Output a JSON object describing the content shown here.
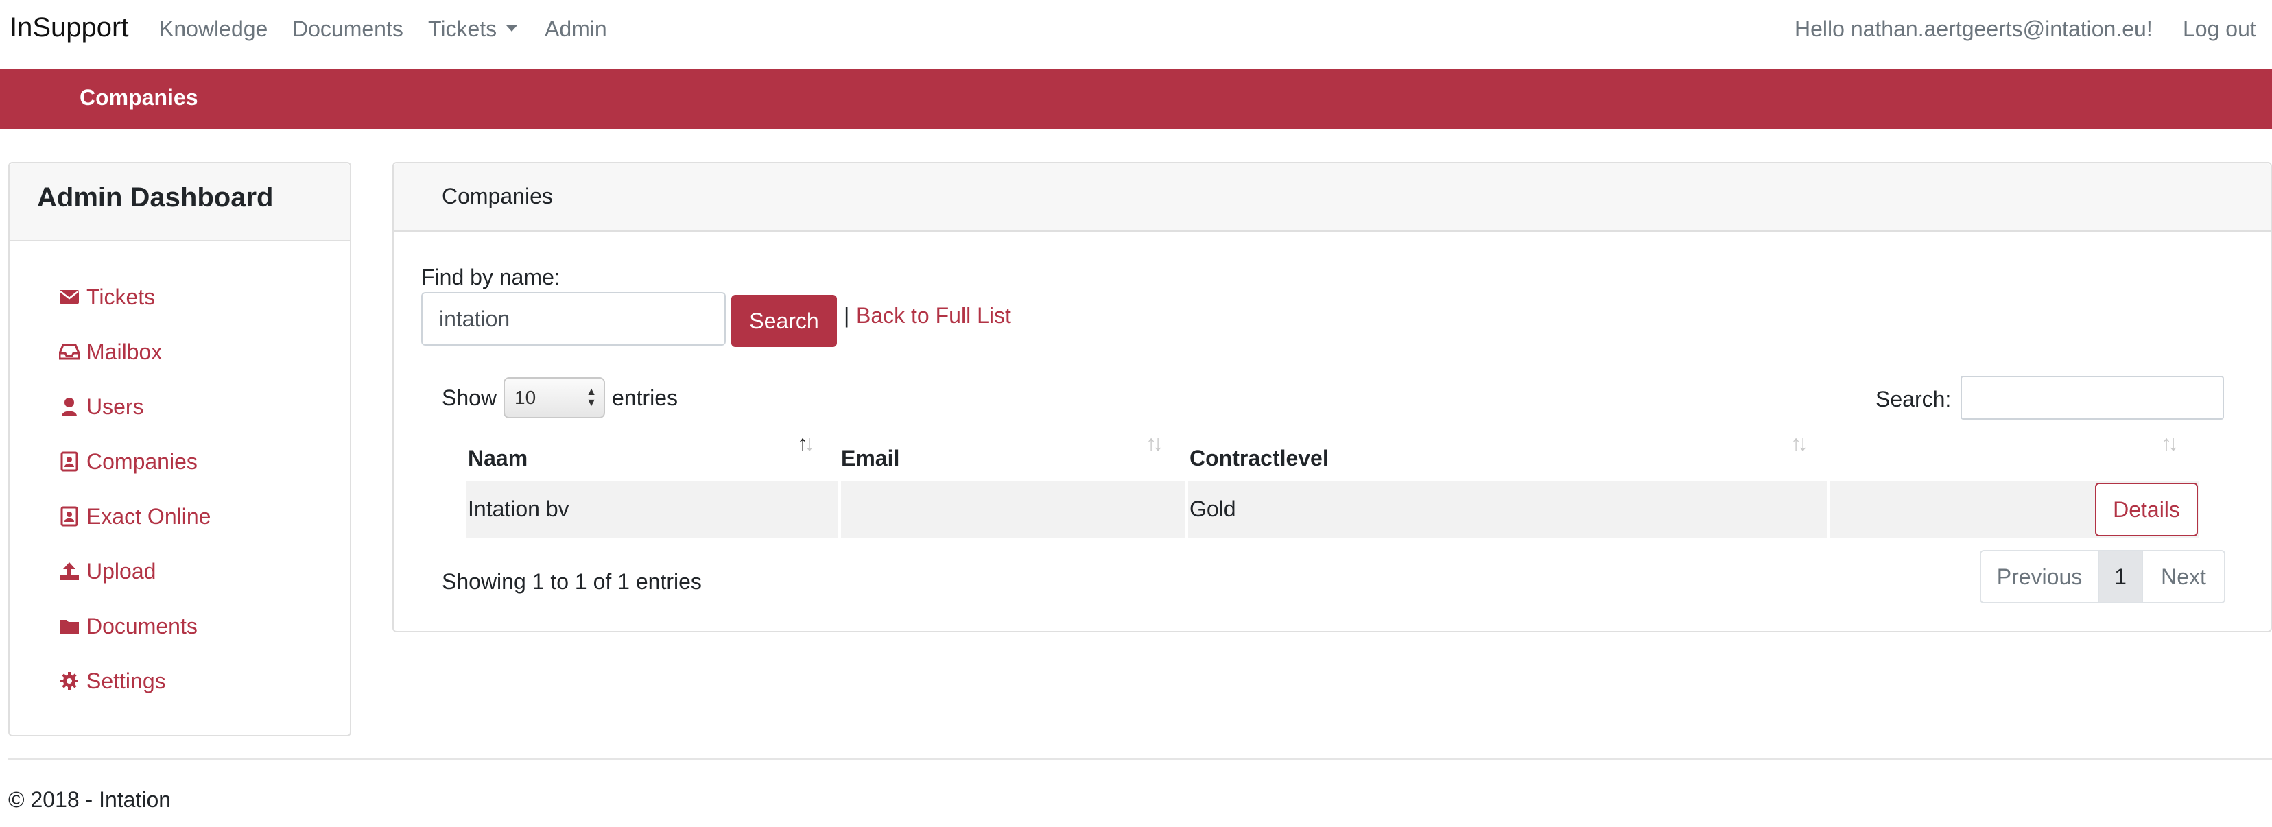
{
  "nav": {
    "brand": "InSupport",
    "links": [
      "Knowledge",
      "Documents",
      "Tickets",
      "Admin"
    ],
    "greeting": "Hello nathan.aertgeerts@intation.eu!",
    "logout": "Log out"
  },
  "band": {
    "title": "Companies"
  },
  "sidebar": {
    "title": "Admin Dashboard",
    "items": [
      {
        "label": "Tickets",
        "icon": "envelope-icon"
      },
      {
        "label": "Mailbox",
        "icon": "inbox-icon"
      },
      {
        "label": "Users",
        "icon": "user-icon"
      },
      {
        "label": "Companies",
        "icon": "contact-card-icon"
      },
      {
        "label": "Exact Online",
        "icon": "contact-card-icon"
      },
      {
        "label": "Upload",
        "icon": "upload-icon"
      },
      {
        "label": "Documents",
        "icon": "folder-icon"
      },
      {
        "label": "Settings",
        "icon": "gear-icon"
      }
    ]
  },
  "main": {
    "title": "Companies",
    "find_label": "Find by name:",
    "find_value": "intation",
    "search_button": "Search",
    "separator": "|",
    "back_link": "Back to Full List",
    "show_label": "Show",
    "page_length": "10",
    "entries_label": "entries",
    "search_label": "Search:",
    "table": {
      "headers": [
        "Naam",
        "Email",
        "Contractlevel",
        ""
      ],
      "rows": [
        {
          "naam": "Intation bv",
          "email": "",
          "contractlevel": "Gold",
          "action": "Details"
        }
      ]
    },
    "info": "Showing 1 to 1 of 1 entries",
    "pager": {
      "previous": "Previous",
      "current": "1",
      "next": "Next"
    }
  },
  "footer": {
    "text": "© 2018 - Intation"
  },
  "colors": {
    "accent": "#b23345",
    "muted": "#6c757d"
  }
}
